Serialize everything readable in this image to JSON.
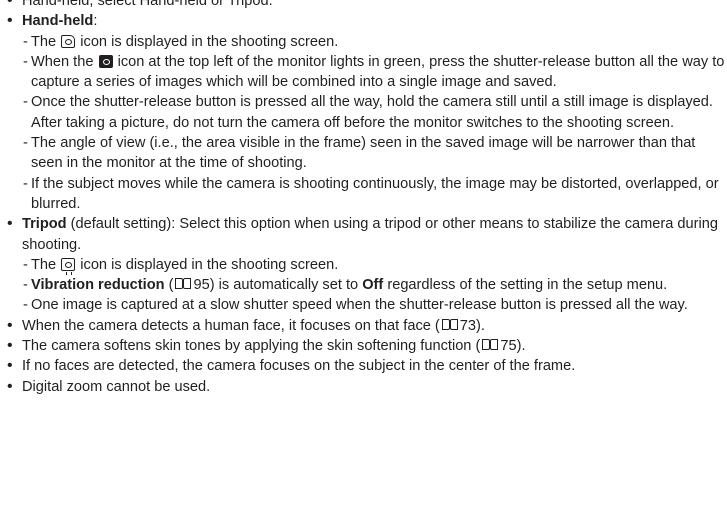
{
  "top_cut_line": "Hand-held, select Hand-held or Tripod.",
  "handheld": {
    "label": "Hand-held",
    "colon": ":",
    "items": [
      {
        "before": "The",
        "icon": "handheld-mode-icon",
        "after": "icon is displayed in the shooting screen."
      },
      {
        "before": "When the",
        "icon": "ready-indicator-icon",
        "after": "icon at the top left of the monitor lights in green, press the shutter-release button all the way to capture a series of images which will be combined into a single image and saved."
      },
      {
        "text": "Once the shutter-release button is pressed all the way, hold the camera still until a still image is displayed. After taking a picture, do not turn the camera off before the monitor switches to the shooting screen."
      },
      {
        "text": "The angle of view (i.e., the area visible in the frame) seen in the saved image will be narrower than that seen in the monitor at the time of shooting."
      },
      {
        "text": "If the subject moves while the camera is shooting continuously, the image may be distorted, overlapped, or blurred."
      }
    ]
  },
  "tripod": {
    "label": "Tripod",
    "desc": "(default setting): Select this option when using a tripod or other means to stabilize the camera during shooting.",
    "item1_before": "The",
    "item1_icon": "tripod-mode-icon",
    "item1_after": "icon is displayed in the shooting screen.",
    "vr_label": "Vibration reduction",
    "vr_paren_open": "(",
    "book_icon": "book-reference-icon",
    "vr_page": "95",
    "vr_mid": ") is automatically set to",
    "vr_off": "Off",
    "vr_end": "regardless of the setting in the setup menu.",
    "item3": "One image is captured at a slow shutter speed when the shutter-release button is pressed all the way."
  },
  "bullets": {
    "face_text": "When the camera detects a human face, it focuses on that face (",
    "face_page": "73",
    "face_close": ").",
    "skin_text": "The camera softens skin tones by applying the skin softening function (",
    "skin_page": "75",
    "skin_close": ").",
    "noface": "If no faces are detected, the camera focuses on the subject in the center of the frame.",
    "zoom": "Digital zoom cannot be used."
  }
}
